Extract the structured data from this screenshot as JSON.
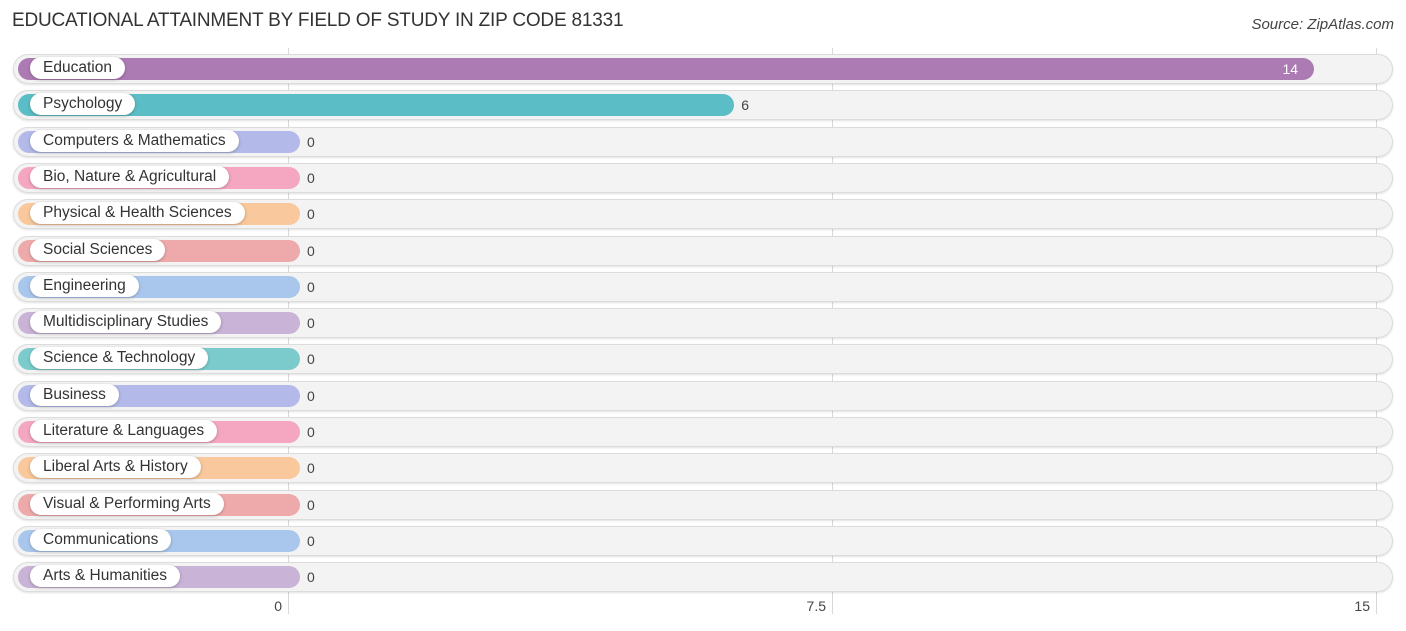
{
  "header": {
    "title": "EDUCATIONAL ATTAINMENT BY FIELD OF STUDY IN ZIP CODE 81331",
    "source": "Source: ZipAtlas.com"
  },
  "chart_data": {
    "type": "bar",
    "orientation": "horizontal",
    "title": "EDUCATIONAL ATTAINMENT BY FIELD OF STUDY IN ZIP CODE 81331",
    "xlabel": "",
    "ylabel": "",
    "xlim": [
      0,
      15
    ],
    "xticks": [
      0,
      7.5,
      15
    ],
    "xtick_labels": [
      "0",
      "7.5",
      "15"
    ],
    "grid": true,
    "categories": [
      "Education",
      "Psychology",
      "Computers & Mathematics",
      "Bio, Nature & Agricultural",
      "Physical & Health Sciences",
      "Social Sciences",
      "Engineering",
      "Multidisciplinary Studies",
      "Science & Technology",
      "Business",
      "Literature & Languages",
      "Liberal Arts & History",
      "Visual & Performing Arts",
      "Communications",
      "Arts & Humanities"
    ],
    "values": [
      14,
      6,
      0,
      0,
      0,
      0,
      0,
      0,
      0,
      0,
      0,
      0,
      0,
      0,
      0
    ],
    "value_labels": [
      "14",
      "6",
      "0",
      "0",
      "0",
      "0",
      "0",
      "0",
      "0",
      "0",
      "0",
      "0",
      "0",
      "0",
      "0"
    ],
    "colors": [
      "#ad7bb3",
      "#5bbdc6",
      "#b3b9e8",
      "#f5a6c0",
      "#f9c89c",
      "#eeaaaa",
      "#a9c7ec",
      "#c9b3d6",
      "#7ccbcc",
      "#b3b9e8",
      "#f5a6c0",
      "#f9c89c",
      "#eeaaaa",
      "#a9c7ec",
      "#c9b3d6"
    ]
  }
}
